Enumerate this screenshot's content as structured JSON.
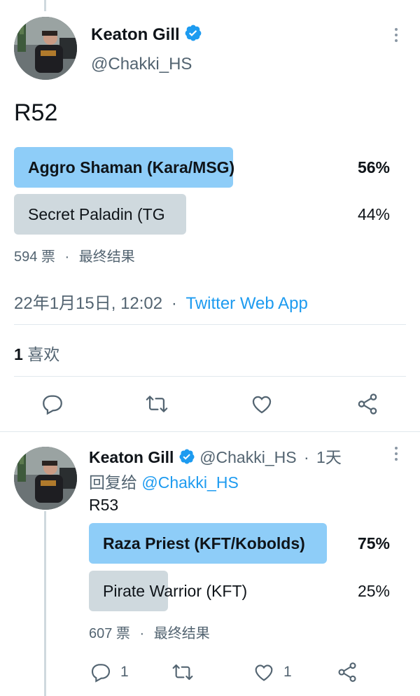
{
  "tweet1": {
    "author_name": "Keaton Gill",
    "handle": "@Chakki_HS",
    "text": "R52",
    "poll": [
      {
        "label": "Aggro Shaman (Kara/MSG)",
        "percent": "56%",
        "fraction": 0.56,
        "winner": true
      },
      {
        "label": "Secret Paladin (TG",
        "percent": "44%",
        "fraction": 0.44,
        "winner": false
      }
    ],
    "votes": "594 票",
    "dot": "·",
    "poll_status": "最终结果",
    "timestamp": "22年1月15日, 12:02",
    "source_sep": "·",
    "source": "Twitter Web App",
    "likes_count": "1",
    "likes_label": "喜欢"
  },
  "tweet2": {
    "author_name": "Keaton Gill",
    "handle": "@Chakki_HS",
    "time_sep": "·",
    "time": "1天",
    "reply_prefix": "回复给",
    "reply_handle": "@Chakki_HS",
    "text": "R53",
    "poll": [
      {
        "label": "Raza Priest (KFT/Kobolds)",
        "percent": "75%",
        "fraction": 0.75,
        "winner": true
      },
      {
        "label": "Pirate Warrior (KFT)",
        "percent": "25%",
        "fraction": 0.25,
        "winner": false
      }
    ],
    "votes": "607 票",
    "dot": "·",
    "poll_status": "最终结果",
    "reply_count": "1",
    "like_count": "1"
  },
  "colors": {
    "accent": "#1d9bf0",
    "winner_bar": "#8ecdf8",
    "loser_bar": "#cfd9de",
    "muted_text": "#536471",
    "icon": "#536471"
  },
  "icons": [
    "verified-badge-icon",
    "more-options-icon",
    "reply-icon",
    "retweet-icon",
    "like-icon",
    "share-icon"
  ]
}
